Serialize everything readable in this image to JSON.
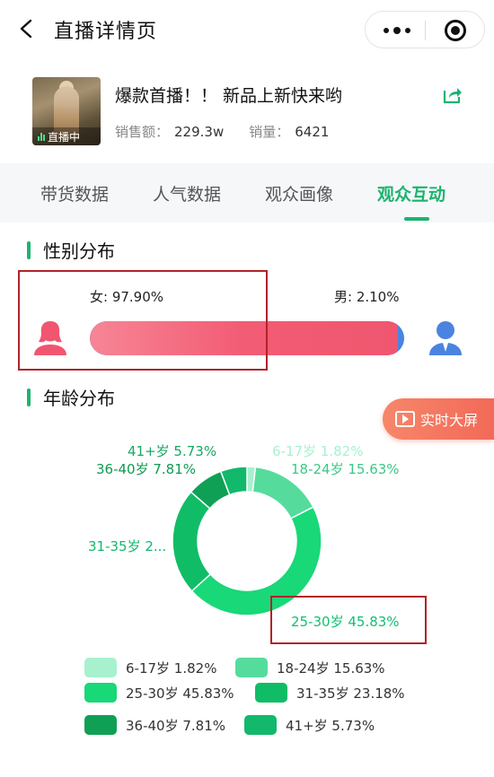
{
  "header": {
    "title": "直播详情页"
  },
  "product": {
    "title": "爆款首播！！ 新品上新快来哟",
    "live_tag": "直播中",
    "sales_label": "销售额：",
    "sales_value": "229.3w",
    "volume_label": "销量：",
    "volume_value": "6421"
  },
  "tabs": [
    {
      "label": "带货数据"
    },
    {
      "label": "人气数据"
    },
    {
      "label": "观众画像"
    },
    {
      "label": "观众互动"
    }
  ],
  "gender": {
    "title": "性别分布",
    "female_label": "女: 97.90%",
    "male_label": "男: 2.10%",
    "female_share": 0.979
  },
  "age": {
    "title": "年龄分布"
  },
  "realtime_button": {
    "label": "实时大屏"
  },
  "colors": {
    "accent": "#1db370",
    "female": "#f0566f",
    "male": "#4a84e0",
    "highlight_box": "#b0232a"
  },
  "chart_data": {
    "type": "pie",
    "donut": true,
    "categories": [
      "6-17岁",
      "18-24岁",
      "25-30岁",
      "31-35岁",
      "36-40岁",
      "41+岁"
    ],
    "values": [
      1.82,
      15.63,
      45.83,
      23.18,
      7.81,
      5.73
    ],
    "colors": [
      "#a7f1cf",
      "#55dc9d",
      "#18d878",
      "#10bd66",
      "#0fa055",
      "#12b86b"
    ],
    "slice_labels": [
      "6-17岁 1.82%",
      "18-24岁 15.63%",
      "25-30岁 45.83%",
      "31-35岁 2...",
      "36-40岁 7.81%",
      "41+岁 5.73%"
    ],
    "legend": [
      "6-17岁 1.82%",
      "18-24岁 15.63%",
      "25-30岁 45.83%",
      "31-35岁 23.18%",
      "36-40岁 7.81%",
      "41+岁 5.73%"
    ],
    "legend_position": "bottom"
  }
}
